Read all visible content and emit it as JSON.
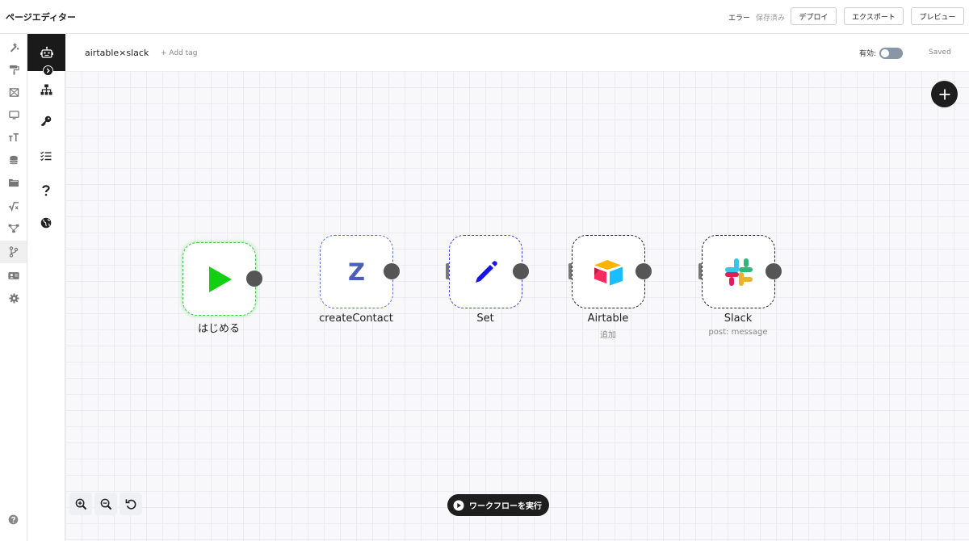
{
  "topbar": {
    "title": "ページエディター",
    "status_error": "エラー",
    "status_saved": "保存済み",
    "deploy": "デプロイ",
    "export": "エクスポート",
    "preview": "プレビュー"
  },
  "rail": {
    "items": [
      "design-icon",
      "paint-roller-icon",
      "image-icon",
      "monitor-icon",
      "text-size-icon",
      "database-icon",
      "folder-icon",
      "formula-icon",
      "flow-icon",
      "branch-icon",
      "id-card-icon",
      "gear-icon"
    ],
    "active_index": 9,
    "help": "help-icon"
  },
  "panel": {
    "items": [
      "robot-icon",
      "sitemap-icon",
      "key-icon",
      "checklist-icon",
      "question-icon",
      "globe-icon"
    ]
  },
  "editor": {
    "workflow_name": "airtable×slack",
    "add_tag": "+ Add tag",
    "enabled_label": "有効:",
    "enabled": false,
    "saved": "Saved"
  },
  "nodes": [
    {
      "id": "start",
      "label": "はじめる",
      "sub": "",
      "icon": "play-icon"
    },
    {
      "id": "zoho",
      "label": "createContact",
      "sub": "",
      "icon": "zoho-icon"
    },
    {
      "id": "set",
      "label": "Set",
      "sub": "",
      "icon": "pencil-icon"
    },
    {
      "id": "airtable",
      "label": "Airtable",
      "sub": "追加",
      "icon": "airtable-icon"
    },
    {
      "id": "slack",
      "label": "Slack",
      "sub": "post: message",
      "icon": "slack-icon"
    }
  ],
  "zoho_letter": "Z",
  "run_button": "ワークフローを実行",
  "colors": {
    "start_border": "#42c94a",
    "play_fill": "#11d011",
    "pencil_fill": "#1515e8",
    "dark": "#1e1e1e"
  }
}
